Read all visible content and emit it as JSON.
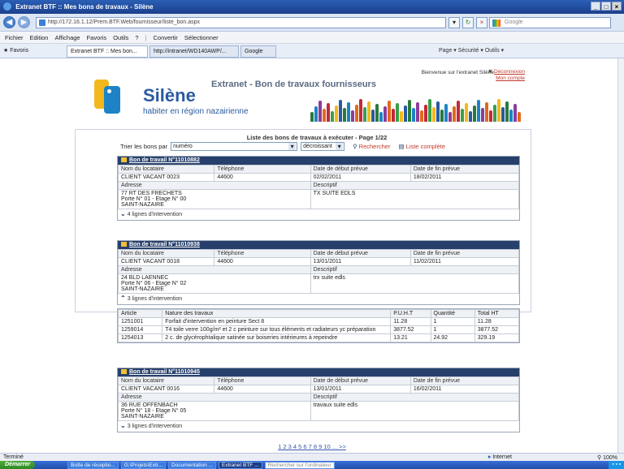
{
  "window": {
    "title": "Extranet BTF :: Mes bons de travaux - Silène"
  },
  "browser": {
    "url": "http://172.16.1.12/Prem.BTF.Web/fournisseur/liste_bon.aspx",
    "search_placeholder": "Google",
    "menu": [
      "Fichier",
      "Edition",
      "Affichage",
      "Favoris",
      "Outils",
      "?"
    ],
    "toolbar_extra": [
      "Convertir",
      "Sélectionner"
    ],
    "favorites_label": "Favoris",
    "tabs": [
      "Extranet BTF :: Mes bon...",
      "http://intranet/WD140AWP/...",
      "Google"
    ],
    "commands": "Page ▾  Sécurité ▾  Outils ▾"
  },
  "site": {
    "brand": "Silène",
    "tagline": "habiter en région nazairienne",
    "title": "Extranet - Bon de travaux fournisseurs",
    "welcome": "Bienvenue sur l'extranet Silène",
    "logout": "Déconnexion",
    "account": "Mon compte"
  },
  "list": {
    "heading": "Liste des bons de travaux à exécuter - Page 1/22",
    "sort_label": "Trier les bons par",
    "sort_value": "numéro",
    "order_value": "décroissant",
    "search_link": "Rechercher",
    "full_list_link": "Liste complète"
  },
  "labels": {
    "tenant": "Nom du locataire",
    "phone": "Téléphone",
    "start": "Date de début prévue",
    "end": "Date de fin prévue",
    "address": "Adresse",
    "desc": "Descriptif"
  },
  "bons": [
    {
      "title": "Bon de travail N°11010882",
      "tenant": "CLIENT VACANT 0023",
      "phone": "44600",
      "start": "02/02/2011",
      "end": "18/02/2011",
      "addr1": "77 RT DES FRECHETS",
      "addr2": "Porte N° 01 - Etage N° 00",
      "addr3": "SAINT-NAZAIRE",
      "desc": "TX SUITE EDLS",
      "lines": "4 lignes d'intervention"
    },
    {
      "title": "Bon de travail N°11010938",
      "tenant": "CLIENT VACANT 0018",
      "phone": "44600",
      "start": "13/01/2011",
      "end": "11/02/2011",
      "addr1": "24 BLD LAENNEC",
      "addr2": "Porte N° 06 - Etage N° 02",
      "addr3": "SAINT-NAZAIRE",
      "desc": "trx suite edls",
      "lines": "3 lignes d'intervention"
    },
    {
      "title": "Bon de travail N°11010945",
      "tenant": "CLIENT VACANT 0016",
      "phone": "44600",
      "start": "13/01/2011",
      "end": "16/02/2011",
      "addr1": "36 RUE OFFENBACH",
      "addr2": "Porte N° 18 - Etage N° 05",
      "addr3": "SAINT-NAZAIRE",
      "desc": "travaux suite edls",
      "lines": "3 lignes d'intervention"
    }
  ],
  "detail": {
    "headers": [
      "Article",
      "Nature des travaux",
      "P.U.H.T",
      "Quantité",
      "Total HT"
    ],
    "rows": [
      [
        "1251001",
        "Forfait d'intervention en peinture Sect 8",
        "11.28",
        "1",
        "11.28"
      ],
      [
        "1259014",
        "T4 toile verre 100g/m² et 2 c peinture sur tous éléments et radiateurs yc préparation",
        "3877.52",
        "1",
        "3877.52"
      ],
      [
        "1254013",
        "2 c. de glycérophtalique satinée sur boiseries intérieures à repeindre",
        "13.21",
        "24.92",
        "329.19"
      ]
    ]
  },
  "pager": "1 2 3 4 5 6 7 8 9 10 ... >>",
  "status": {
    "left": "Terminé",
    "zone": "Internet",
    "zoom": "100%"
  },
  "taskbar": {
    "start": "Démarrer",
    "items": [
      "Boîte de réceptio...",
      "G:\\Projets\\Extr...",
      "Documentation ...",
      "Extranet BTF ...",
      "Rechercher sur l'ordinateur"
    ]
  }
}
